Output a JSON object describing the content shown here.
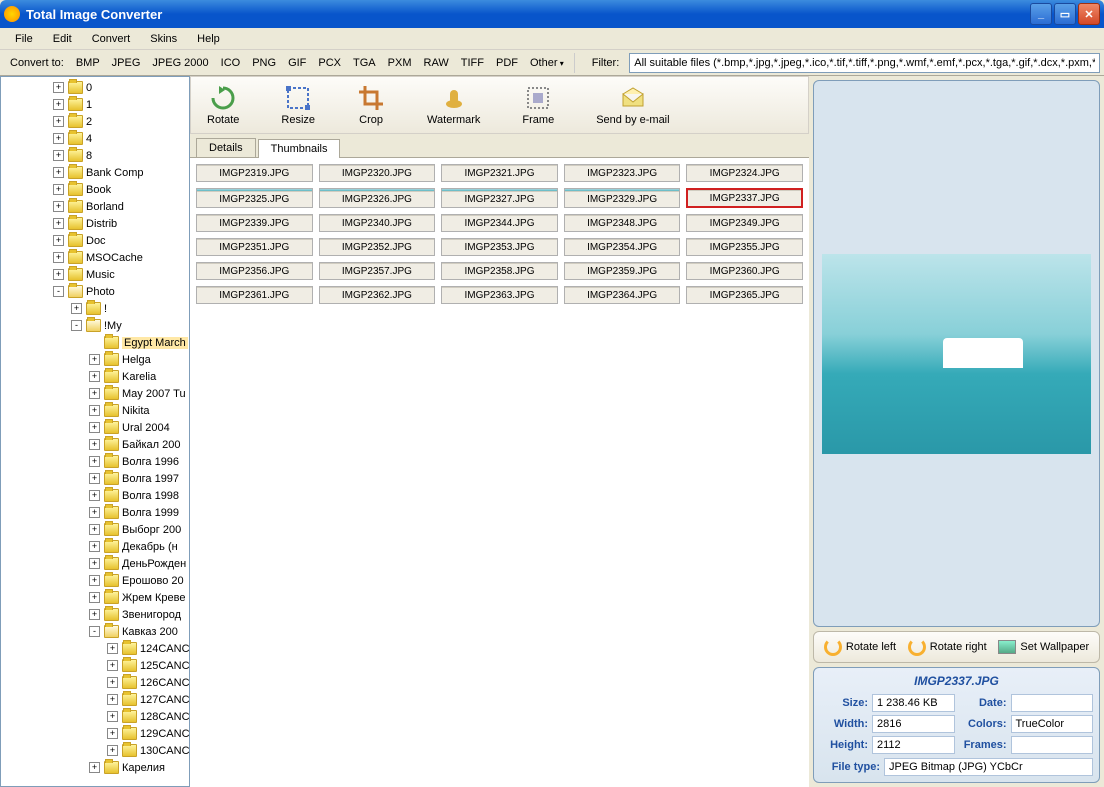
{
  "title": "Total Image Converter",
  "menu": [
    "File",
    "Edit",
    "Convert",
    "Skins",
    "Help"
  ],
  "convert_label": "Convert to:",
  "formats": [
    "BMP",
    "JPEG",
    "JPEG 2000",
    "ICO",
    "PNG",
    "GIF",
    "PCX",
    "TGA",
    "PXM",
    "RAW",
    "TIFF",
    "PDF",
    "Other"
  ],
  "filter_label": "Filter:",
  "filter_value": "All suitable files (*.bmp,*.jpg,*.jpeg,*.ico,*.tif,*.tiff,*.png,*.wmf,*.emf,*.pcx,*.tga,*.gif,*.dcx,*.pxm,*.ppi",
  "tree": [
    {
      "depth": 0,
      "toggle": "+",
      "label": "0"
    },
    {
      "depth": 0,
      "toggle": "+",
      "label": "1"
    },
    {
      "depth": 0,
      "toggle": "+",
      "label": "2"
    },
    {
      "depth": 0,
      "toggle": "+",
      "label": "4"
    },
    {
      "depth": 0,
      "toggle": "+",
      "label": "8"
    },
    {
      "depth": 0,
      "toggle": "+",
      "label": "Bank Comp"
    },
    {
      "depth": 0,
      "toggle": "+",
      "label": "Book"
    },
    {
      "depth": 0,
      "toggle": "+",
      "label": "Borland"
    },
    {
      "depth": 0,
      "toggle": "+",
      "label": "Distrib"
    },
    {
      "depth": 0,
      "toggle": "+",
      "label": "Doc"
    },
    {
      "depth": 0,
      "toggle": "+",
      "label": "MSOCache"
    },
    {
      "depth": 0,
      "toggle": "+",
      "label": "Music"
    },
    {
      "depth": 0,
      "toggle": "-",
      "label": "Photo",
      "open": true
    },
    {
      "depth": 1,
      "toggle": "+",
      "label": "!"
    },
    {
      "depth": 1,
      "toggle": "-",
      "label": "!My",
      "open": true
    },
    {
      "depth": 2,
      "toggle": "",
      "label": "Egypt March",
      "selected": true
    },
    {
      "depth": 2,
      "toggle": "+",
      "label": "Helga"
    },
    {
      "depth": 2,
      "toggle": "+",
      "label": "Karelia"
    },
    {
      "depth": 2,
      "toggle": "+",
      "label": "May 2007 Tu"
    },
    {
      "depth": 2,
      "toggle": "+",
      "label": "Nikita"
    },
    {
      "depth": 2,
      "toggle": "+",
      "label": "Ural 2004"
    },
    {
      "depth": 2,
      "toggle": "+",
      "label": "Байкал 200"
    },
    {
      "depth": 2,
      "toggle": "+",
      "label": "Волга 1996"
    },
    {
      "depth": 2,
      "toggle": "+",
      "label": "Волга 1997"
    },
    {
      "depth": 2,
      "toggle": "+",
      "label": "Волга 1998"
    },
    {
      "depth": 2,
      "toggle": "+",
      "label": "Волга 1999"
    },
    {
      "depth": 2,
      "toggle": "+",
      "label": "Выборг 200"
    },
    {
      "depth": 2,
      "toggle": "+",
      "label": "Декабрь (н"
    },
    {
      "depth": 2,
      "toggle": "+",
      "label": "ДеньРожден"
    },
    {
      "depth": 2,
      "toggle": "+",
      "label": "Ерошово 20"
    },
    {
      "depth": 2,
      "toggle": "+",
      "label": "Жрем Креве"
    },
    {
      "depth": 2,
      "toggle": "+",
      "label": "Звенигород"
    },
    {
      "depth": 2,
      "toggle": "-",
      "label": "Кавказ 200",
      "open": true
    },
    {
      "depth": 3,
      "toggle": "+",
      "label": "124CANC"
    },
    {
      "depth": 3,
      "toggle": "+",
      "label": "125CANC"
    },
    {
      "depth": 3,
      "toggle": "+",
      "label": "126CANC"
    },
    {
      "depth": 3,
      "toggle": "+",
      "label": "127CANC"
    },
    {
      "depth": 3,
      "toggle": "+",
      "label": "128CANC"
    },
    {
      "depth": 3,
      "toggle": "+",
      "label": "129CANC"
    },
    {
      "depth": 3,
      "toggle": "+",
      "label": "130CANC"
    },
    {
      "depth": 2,
      "toggle": "+",
      "label": "Карелия"
    }
  ],
  "toolbar": [
    {
      "label": "Rotate",
      "icon": "rotate"
    },
    {
      "label": "Resize",
      "icon": "resize"
    },
    {
      "label": "Crop",
      "icon": "crop"
    },
    {
      "label": "Watermark",
      "icon": "watermark"
    },
    {
      "label": "Frame",
      "icon": "frame"
    },
    {
      "label": "Send by e-mail",
      "icon": "email"
    }
  ],
  "tabs": [
    {
      "label": "Details",
      "active": false
    },
    {
      "label": "Thumbnails",
      "active": true
    }
  ],
  "thumbnails": [
    {
      "name": "IMGP2319.JPG",
      "style": "water"
    },
    {
      "name": "IMGP2320.JPG",
      "style": "water"
    },
    {
      "name": "IMGP2321.JPG",
      "style": "water"
    },
    {
      "name": "IMGP2323.JPG",
      "style": "water"
    },
    {
      "name": "IMGP2324.JPG",
      "style": "water"
    },
    {
      "name": "IMGP2325.JPG",
      "style": "water"
    },
    {
      "name": "IMGP2326.JPG",
      "style": "water"
    },
    {
      "name": "IMGP2327.JPG",
      "style": "water"
    },
    {
      "name": "IMGP2329.JPG",
      "style": "water"
    },
    {
      "name": "IMGP2337.JPG",
      "style": "water",
      "selected": true
    },
    {
      "name": "IMGP2339.JPG",
      "style": ""
    },
    {
      "name": "IMGP2340.JPG",
      "style": ""
    },
    {
      "name": "IMGP2344.JPG",
      "style": ""
    },
    {
      "name": "IMGP2348.JPG",
      "style": ""
    },
    {
      "name": "IMGP2349.JPG",
      "style": ""
    },
    {
      "name": "IMGP2351.JPG",
      "style": ""
    },
    {
      "name": "IMGP2352.JPG",
      "style": ""
    },
    {
      "name": "IMGP2353.JPG",
      "style": ""
    },
    {
      "name": "IMGP2354.JPG",
      "style": ""
    },
    {
      "name": "IMGP2355.JPG",
      "style": ""
    },
    {
      "name": "IMGP2356.JPG",
      "style": ""
    },
    {
      "name": "IMGP2357.JPG",
      "style": ""
    },
    {
      "name": "IMGP2358.JPG",
      "style": ""
    },
    {
      "name": "IMGP2359.JPG",
      "style": ""
    },
    {
      "name": "IMGP2360.JPG",
      "style": ""
    },
    {
      "name": "IMGP2361.JPG",
      "style": "dark"
    },
    {
      "name": "IMGP2362.JPG",
      "style": "dark"
    },
    {
      "name": "IMGP2363.JPG",
      "style": "dark"
    },
    {
      "name": "IMGP2364.JPG",
      "style": "dark"
    },
    {
      "name": "IMGP2365.JPG",
      "style": "dark"
    }
  ],
  "actions": {
    "rotate_left": "Rotate left",
    "rotate_right": "Rotate right",
    "set_wallpaper": "Set Wallpaper"
  },
  "info": {
    "filename": "IMGP2337.JPG",
    "size_label": "Size:",
    "size_value": "1 238.46 KB",
    "date_label": "Date:",
    "date_value": "",
    "width_label": "Width:",
    "width_value": "2816",
    "colors_label": "Colors:",
    "colors_value": "TrueColor",
    "height_label": "Height:",
    "height_value": "2112",
    "frames_label": "Frames:",
    "frames_value": "",
    "filetype_label": "File type:",
    "filetype_value": "JPEG Bitmap (JPG) YCbCr"
  }
}
